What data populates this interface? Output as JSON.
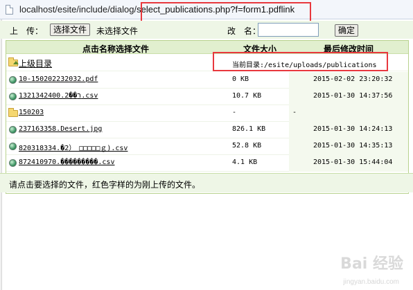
{
  "address_bar": {
    "url_prefix": "localhost/esite/include/dialog/",
    "url_highlight": "select_publications.php?f=form1.pdflink"
  },
  "upload": {
    "upload_label": "上　传：",
    "choose_file_button": "选择文件",
    "no_file_text": "未选择文件",
    "rename_label": "改　名：",
    "rename_value": "",
    "confirm_button": "确定"
  },
  "table": {
    "headers": {
      "name": "点击名称选择文件",
      "size": "文件大小",
      "modified": "最后修改时间"
    },
    "parent_dir": {
      "label": "上级目录",
      "current_dir": "当前目录:/esite/uploads/publications"
    },
    "rows": [
      {
        "name": "10-150202232032.pdf",
        "size": "0 KB",
        "modified": "2015-02-02 23:20:32",
        "icon": "file-icon"
      },
      {
        "name": "1321342400.2��ר.csv",
        "size": "10.7 KB",
        "modified": "2015-01-30 14:37:56",
        "icon": "file-icon"
      },
      {
        "name": "150203",
        "size": "-",
        "modified": "-",
        "icon": "folder-icon"
      },
      {
        "name": "237163358.Desert.jpg",
        "size": "826.1 KB",
        "modified": "2015-01-30 14:24:13",
        "icon": "file-icon"
      },
      {
        "name": "820318334.�2）　□□□□□ｇ).csv",
        "size": "52.8 KB",
        "modified": "2015-01-30 14:35:13",
        "icon": "file-icon"
      },
      {
        "name": "872410970.���������.csv",
        "size": "4.1 KB",
        "modified": "2015-01-30 15:44:04",
        "icon": "file-icon"
      }
    ]
  },
  "footer": {
    "note": "请点击要选择的文件，红色字样的为刚上传的文件。"
  },
  "watermark": {
    "brand": "Bai 经验",
    "sub": "jingyan.baidu.com"
  },
  "colors": {
    "header_bg": "#e1efcf",
    "annotation_red": "#e8383d"
  }
}
